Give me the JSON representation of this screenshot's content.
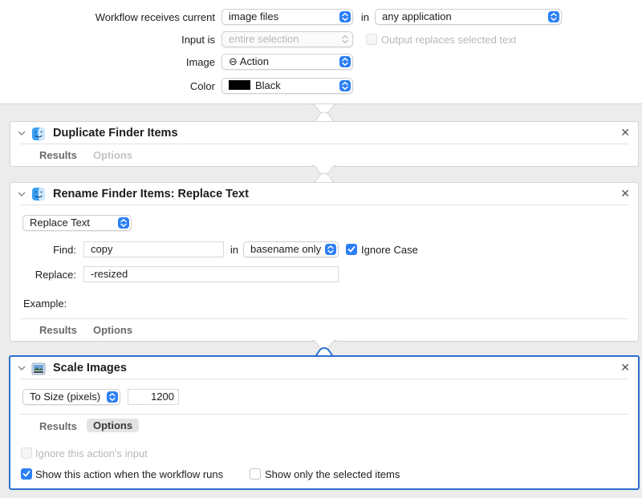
{
  "header": {
    "receives_label": "Workflow receives current",
    "receives_value": "image files",
    "in_label": "in",
    "application_value": "any application",
    "input_is_label": "Input is",
    "input_is_value": "entire selection",
    "output_replaces_label": "Output replaces selected text",
    "image_label": "Image",
    "image_value": "⊖ Action",
    "color_label": "Color",
    "color_value": "Black",
    "color_swatch": "#000000"
  },
  "actions": [
    {
      "title": "Duplicate Finder Items",
      "icon": "finder-icon",
      "tabs": [
        "Results",
        "Options"
      ]
    },
    {
      "title": "Rename Finder Items: Replace Text",
      "icon": "finder-icon",
      "mode_value": "Replace Text",
      "find_label": "Find:",
      "find_value": "copy",
      "in_label": "in",
      "scope_value": "basename only",
      "ignore_case_label": "Ignore Case",
      "replace_label": "Replace:",
      "replace_value": "-resized",
      "example_label": "Example:",
      "tabs": [
        "Results",
        "Options"
      ]
    },
    {
      "title": "Scale Images",
      "icon": "preview-icon",
      "size_mode_value": "To Size (pixels)",
      "size_value": "1200",
      "tabs": [
        "Results",
        "Options"
      ],
      "ignore_input_label": "Ignore this action's input",
      "show_action_label": "Show this action when the workflow runs",
      "show_selected_label": "Show only the selected items"
    }
  ],
  "colors": {
    "accent": "#2c7ff5",
    "selected_border": "#2c6fcf"
  }
}
